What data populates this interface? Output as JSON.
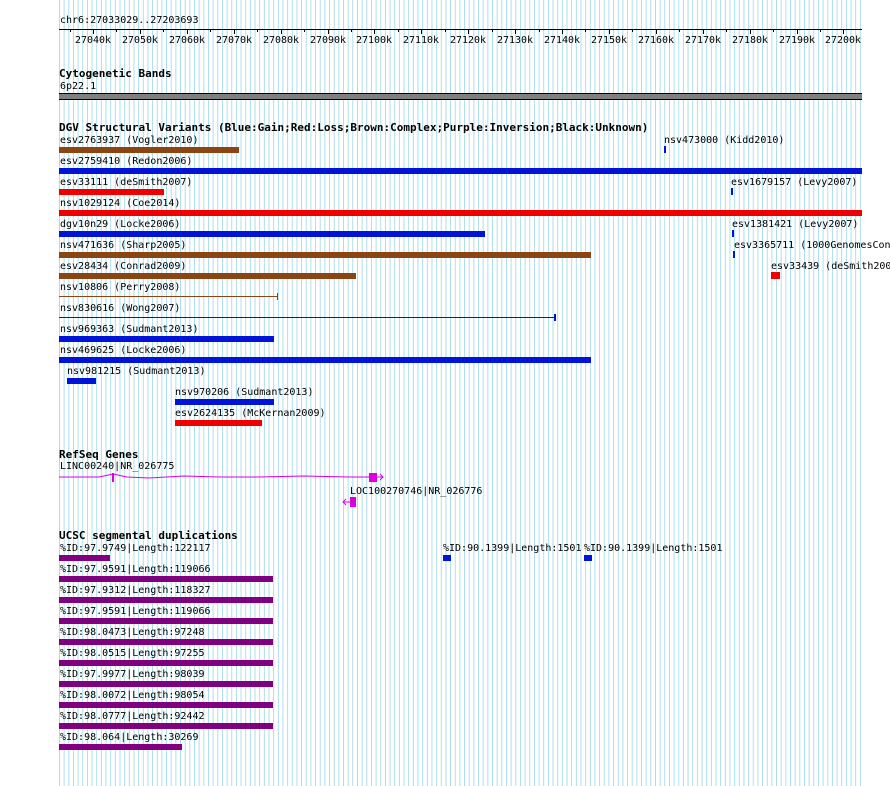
{
  "ruler": {
    "position": "chr6:27033029..27203693",
    "ticks": [
      "27040k",
      "27050k",
      "27060k",
      "27070k",
      "27080k",
      "27090k",
      "27100k",
      "27110k",
      "27120k",
      "27130k",
      "27140k",
      "27150k",
      "27160k",
      "27170k",
      "27180k",
      "27190k",
      "27200k"
    ]
  },
  "cytoband": {
    "title": "Cytogenetic Bands",
    "band": "6p22.1"
  },
  "dgv": {
    "title": "DGV Structural Variants (Blue:Gain;Red:Loss;Brown:Complex;Purple:Inversion;Black:Unknown)",
    "colors": {
      "gain": "#0014d8",
      "loss": "#ee0000",
      "complex": "#8b4513",
      "unknown": "#000000"
    },
    "labels": [
      "esv2763937 (Vogler2010)",
      "nsv473000 (Kidd2010)",
      "esv2759410 (Redon2006)",
      "esv33111 (deSmith2007)",
      "esv1679157 (Levy2007)",
      "nsv1029124 (Coe2014)",
      "dgv10n29 (Locke2006)",
      "esv1381421 (Levy2007)",
      "nsv471636 (Sharp2005)",
      "esv3365711 (1000GenomesCon",
      "esv28434 (Conrad2009)",
      "esv33439 (deSmith200",
      "nsv10806 (Perry2008)",
      "nsv830616 (Wong2007)",
      "nsv969363 (Sudmant2013)",
      "nsv469625 (Locke2006)",
      "nsv981215 (Sudmant2013)",
      "nsv970206 (Sudmant2013)",
      "esv2624135 (McKernan2009)"
    ]
  },
  "refseq": {
    "title": "RefSeq Genes",
    "genes": [
      "LINC00240|NR_026775",
      "LOC100270746|NR_026776"
    ],
    "color": "#dd00dd"
  },
  "segdups": {
    "title": "UCSC segmental duplications",
    "purple": "#800080",
    "blue": "#0014d8",
    "labels": [
      "%ID:97.9749|Length:122117",
      "%ID:90.1399|Length:1501",
      "%ID:90.1399|Length:1501",
      "%ID:97.9591|Length:119066",
      "%ID:97.9312|Length:118327",
      "%ID:97.9591|Length:119066",
      "%ID:98.0473|Length:97248",
      "%ID:98.0515|Length:97255",
      "%ID:97.9977|Length:98039",
      "%ID:98.0072|Length:98054",
      "%ID:98.0777|Length:92442",
      "%ID:98.064|Length:30269"
    ]
  }
}
